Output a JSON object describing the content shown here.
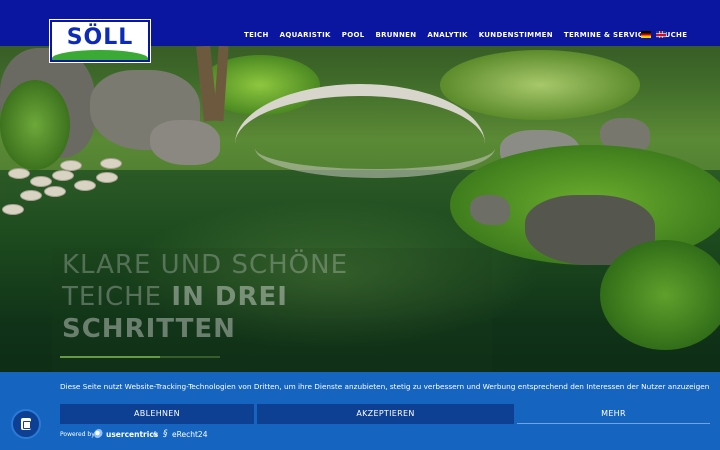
{
  "header": {
    "logo_text": "SÖLL",
    "nav": [
      "TEICH",
      "AQUARISTIK",
      "POOL",
      "BRUNNEN",
      "ANALYTIK",
      "KUNDENSTIMMEN",
      "TERMINE & SERVICE",
      "SUCHE"
    ],
    "languages": [
      "de",
      "en"
    ]
  },
  "hero": {
    "line1": "Klare und schöne",
    "line2_prefix": "Teiche",
    "line2_bold": "in drei",
    "line3": "Schritten"
  },
  "cookie_banner": {
    "text": "Diese Seite nutzt Website-Tracking-Technologien von Dritten, um ihre Dienste anzubieten, stetig zu verbessern und Werbung entsprechend den Interessen der Nutzer anzuzeigen.",
    "deny_label": "ABLEHNEN",
    "accept_label": "AKZEPTIEREN",
    "more_label": "MEHR",
    "powered_by": "Powered by",
    "brand_usercentrics": "usercentrics",
    "ampersand": "&",
    "brand_erecht": "eRecht24"
  },
  "colors": {
    "header_bg": "#0a16a0",
    "banner_bg": "#1565c0",
    "button_bg": "#0d3f93",
    "logo_green": "#3aa935"
  },
  "icons": [
    "privacy-settings-icon",
    "flag-de-icon",
    "flag-en-icon",
    "usercentrics-logo-icon",
    "erecht24-logo-icon"
  ]
}
